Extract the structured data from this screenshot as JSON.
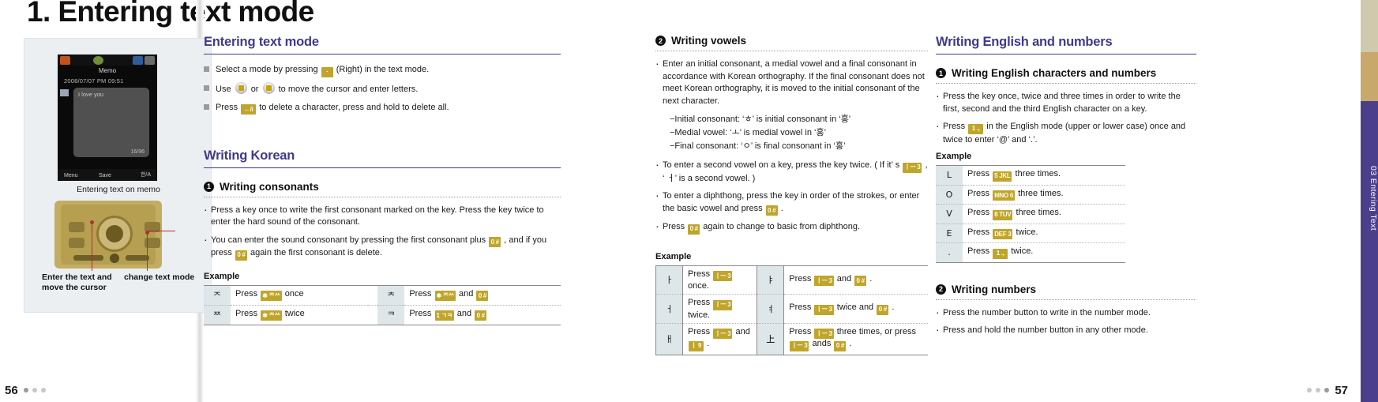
{
  "page": {
    "main_title": "1. Entering text mode",
    "left_page_number": "56",
    "right_page_number": "57",
    "edge_tab_label": "03  Entering Text",
    "colors": {
      "heading_purple": "#3f3a8c",
      "key_chip_yellow": "#bfa52c",
      "glyph_cell_blue": "#dfe6ea",
      "tab_purple": "#4b3f8c"
    }
  },
  "photo": {
    "caption": "Entering text on memo",
    "screen": {
      "title": "Memo",
      "date": "2008/07/07 PM 09:51",
      "body_text": "I love you",
      "counter": "16/96",
      "soft_left": "Menu",
      "soft_mid": "Save",
      "soft_right": "한/A"
    },
    "callout_left": "Enter the text and move the cursor",
    "callout_right": "change text mode"
  },
  "col_a": {
    "section1": {
      "title": "Entering text mode",
      "bullets": [
        {
          "pre": "Select a mode by pressing",
          "key": "·",
          "post": "(Right) in the text mode."
        },
        {
          "pre": "Use",
          "key": "nav1",
          "mid": "or",
          "key2": "nav2",
          "post": "to move the cursor and enter letters."
        },
        {
          "pre": "Press",
          "key": "←/i",
          "post": "to delete a character, press and hold to delete all."
        }
      ]
    },
    "section2": {
      "title": "Writing Korean",
      "sub_number": "1",
      "sub_title": "Writing consonants",
      "bullets": [
        "Press a key once to write the first consonant marked on the key. Press the key twice to enter the hard sound of the consonant.",
        "You can enter the sound consonant by pressing the first consonant plus [0#] , and if you press [0#] again the first consonant is delete."
      ],
      "bullet2_parts": {
        "p1": "You can enter the sound consonant by pressing the first consonant plus",
        "key1": "0 #",
        "p2": ", and if you press",
        "key2": "0 #",
        "p3": "again the first consonant is delete."
      },
      "example_label": "Example",
      "table": [
        {
          "glyph_l": "ᄌ",
          "desc_l_pre": "Press",
          "desc_l_key": "✱ ᄌᄊ",
          "desc_l_post": "once",
          "glyph_r": "ᄎ",
          "desc_r_pre": "Press",
          "desc_r_key": "✱ ᄌᄊ",
          "desc_r_mid": "and",
          "desc_r_key2": "0 #",
          "desc_r_post": ""
        },
        {
          "glyph_l": "ᄍ",
          "desc_l_pre": "Press",
          "desc_l_key": "✱ ᄌᄊ",
          "desc_l_post": "twice",
          "glyph_r": "ᄏ",
          "desc_r_pre": "Press",
          "desc_r_key": "1 ㄱㅋ",
          "desc_r_mid": "and",
          "desc_r_key2": "0 #",
          "desc_r_post": ""
        }
      ]
    }
  },
  "col_b": {
    "sub_number": "2",
    "sub_title": "Writing vowels",
    "bullet1": "Enter an initial consonant, a medial vowel and a final consonant in accordance with Korean orthography. If the final consonant does not meet Korean orthography, it is moved to the initial consonant of the next character.",
    "dashes": [
      "−Initial consonant:   ‘ㅎ’  is initial consonant in   ‘홍’",
      "−Medial vowel:   ‘ㅗ’  is medial vowel in    ‘홍’",
      "−Final consonant:   ‘ㅇ’  is final consonant in   ‘홍’"
    ],
    "bullet2_parts": {
      "p1": "To enter a second vowel on a key, press the key twice. ( If it’",
      "p2": "s",
      "key": "ㅣㅡ 3",
      "p3": ",",
      "p4": "‘   ㅓ’  is a second vowel. )"
    },
    "bullet3_parts": {
      "p1": "To enter a diphthong, press the key in order of the strokes, or enter the basic vowel and press",
      "key": "0 #",
      "p2": "."
    },
    "bullet4_parts": {
      "p1": "Press",
      "key": "0 #",
      "p2": "again to change to basic from diphthong."
    },
    "example_label": "Example",
    "table": [
      {
        "glyph_l": "ㅏ",
        "l_pre": "Press",
        "l_key": "ㅣㅡ 3",
        "l_post": "once.",
        "glyph_r": "ㅑ",
        "r_pre": "Press",
        "r_key": "ㅣㅡ 3",
        "r_mid": "and",
        "r_key2": "0 #",
        "r_post": "."
      },
      {
        "glyph_l": "ㅓ",
        "l_pre": "Press",
        "l_key": "ㅣㅡ 3",
        "l_post": "twice.",
        "glyph_r": "ㅕ",
        "r_pre": "Press",
        "r_key": "ㅣㅡ 3",
        "r_mid": "twice and",
        "r_key2": "0 #",
        "r_post": "."
      },
      {
        "glyph_l": "ㅐ",
        "l_pre": "Press",
        "l_key": "ㅣㅡ 3",
        "l_mid": "and",
        "l_key2": "ㅣ 9",
        "l_post": ".",
        "glyph_r": "㆖",
        "r_pre": "Press",
        "r_key": "ㅣㅡ 3",
        "r_mid": "three times, or press",
        "r_key2": "ㅣㅡ 3",
        "r_mid2": "ands",
        "r_key3": "0 #",
        "r_post": "."
      }
    ]
  },
  "col_c": {
    "title": "Writing English and numbers",
    "section1": {
      "sub_number": "1",
      "sub_title": "Writing English characters and numbers",
      "bullet1": "Press the key once, twice and three times in order to write the first, second and the third English character on a key.",
      "bullet2_parts": {
        "p1": "Press",
        "key": "1 .,",
        "p2": "in the English mode (upper or lower case) once and twice to enter ‘@’ and ‘.’."
      },
      "example_label": "Example",
      "table": [
        {
          "letter": "L",
          "pre": "Press",
          "key": "5 JKL",
          "post": "three times."
        },
        {
          "letter": "O",
          "pre": "Press",
          "key": "MNO 6",
          "post": "three times."
        },
        {
          "letter": "V",
          "pre": "Press",
          "key": "8 TUV",
          "post": "three times."
        },
        {
          "letter": "E",
          "pre": "Press",
          "key": "DEF 3",
          "post": "twice."
        },
        {
          "letter": ".",
          "pre": "Press",
          "key": "1 .,",
          "post": "twice."
        }
      ]
    },
    "section2": {
      "sub_number": "2",
      "sub_title": "Writing numbers",
      "bullets": [
        "Press the number button to write in the number mode.",
        "Press and hold the number button in any other mode."
      ]
    }
  }
}
